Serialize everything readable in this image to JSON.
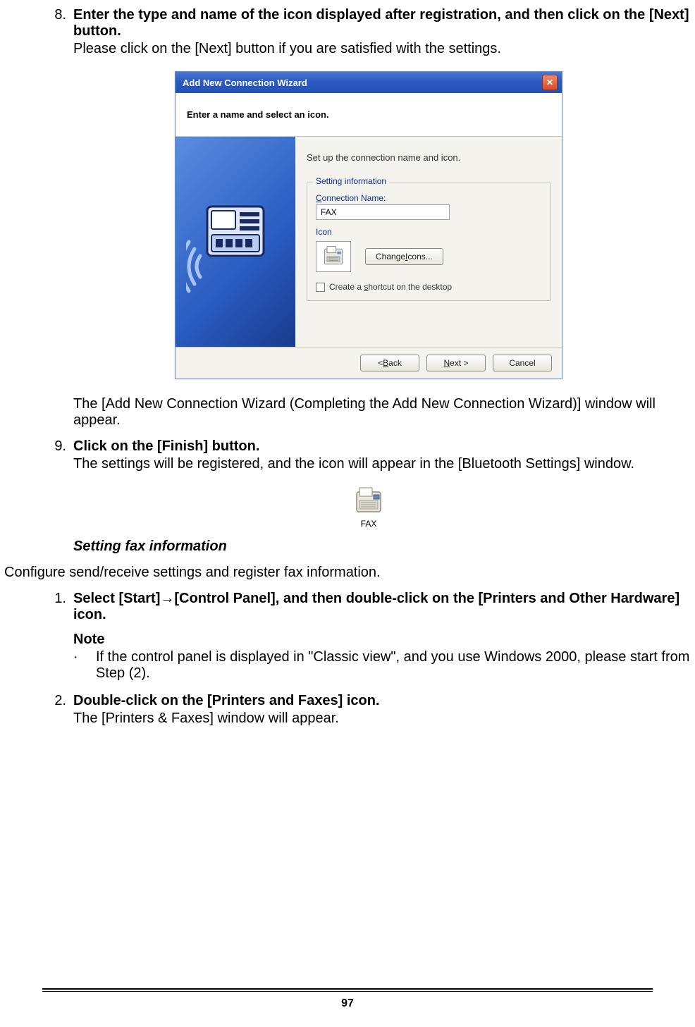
{
  "step8": {
    "num": "8.",
    "title": "Enter the type and name of the icon displayed after registration, and then click on the [Next] button.",
    "body": "Please click on the [Next] button if you are satisfied with the settings.",
    "followup": "The [Add New Connection Wizard (Completing the Add New Connection Wizard)] window will appear."
  },
  "dialog": {
    "title": "Add New Connection Wizard",
    "banner": "Enter a name and select an icon.",
    "instruction": "Set up the connection name and icon.",
    "fieldset_legend": "Setting information",
    "conn_label": "Connection Name:",
    "conn_value": "FAX",
    "icon_label": "Icon",
    "change_icons": "Change Icons...",
    "shortcut_label": "Create a shortcut on the desktop",
    "back": "< Back",
    "next": "Next >",
    "cancel": "Cancel"
  },
  "step9": {
    "num": "9.",
    "title": "Click on the [Finish] button.",
    "body": "The settings will be registered, and the icon will appear in the [Bluetooth Settings] window."
  },
  "fax_icon_label": "FAX",
  "section_title": "Setting fax information",
  "intro": "Configure send/receive settings and register fax information.",
  "step1": {
    "num": "1.",
    "title_pre": "Select [Start]",
    "title_post": "[Control Panel], and then double-click on the [Printers and Other Hardware] icon.",
    "arrow": "→",
    "note_label": "Note",
    "note_bullet": "·",
    "note_body": "If the control panel is displayed in \"Classic view\", and you use Windows 2000, please start from Step (2)."
  },
  "step2": {
    "num": "2.",
    "title": "Double-click on the [Printers and Faxes] icon.",
    "body": "The [Printers & Faxes] window will appear."
  },
  "page_number": "97"
}
